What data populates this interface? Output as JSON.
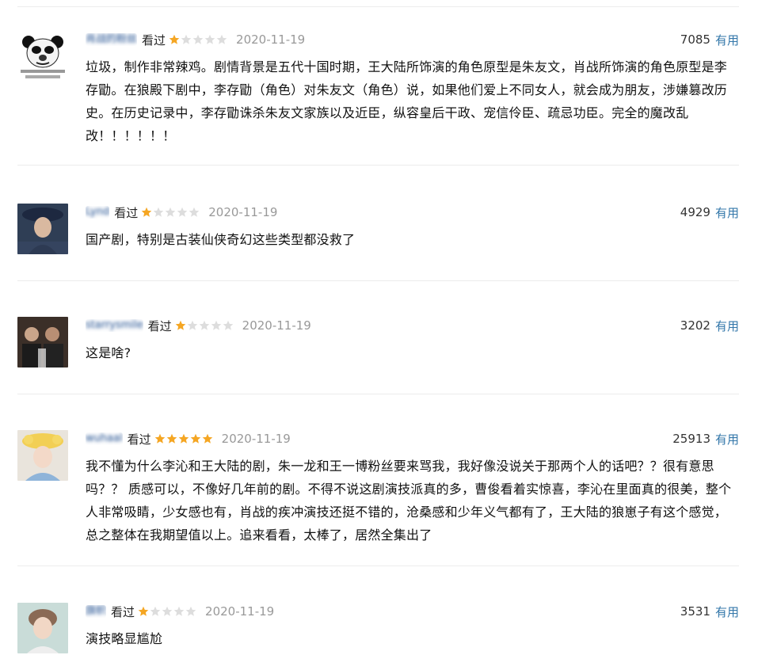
{
  "reviews": [
    {
      "username": "肖战的粉丝",
      "status": "看过",
      "rating": 1,
      "date": "2020-11-19",
      "votes": "7085",
      "useful_label": "有用",
      "avatar_icon": "panda-meme-avatar",
      "content": "垃圾，制作非常辣鸡。剧情背景是五代十国时期，王大陆所饰演的角色原型是朱友文，肖战所饰演的角色原型是李存勖。在狼殿下剧中，李存勖（角色）对朱友文（角色）说，如果他们爱上不同女人，就会成为朋友，涉嫌篡改历史。在历史记录中，李存勖诛杀朱友文家族以及近臣，纵容皇后干政、宠信伶臣、疏忌功臣。完全的魔改乱改！！！！！！"
    },
    {
      "username": "Lynd",
      "status": "看过",
      "rating": 1,
      "date": "2020-11-19",
      "votes": "4929",
      "useful_label": "有用",
      "avatar_icon": "portrait-hat-avatar",
      "content": "国产剧，特别是古装仙侠奇幻这些类型都没救了"
    },
    {
      "username": "starrysmile",
      "status": "看过",
      "rating": 1,
      "date": "2020-11-19",
      "votes": "3202",
      "useful_label": "有用",
      "avatar_icon": "group-photo-avatar",
      "content": "这是啥?"
    },
    {
      "username": "wuhaal",
      "status": "看过",
      "rating": 5,
      "date": "2020-11-19",
      "votes": "25913",
      "useful_label": "有用",
      "avatar_icon": "girl-yellow-hat-avatar",
      "content": "我不懂为什么李沁和王大陆的剧，朱一龙和王一博粉丝要来骂我，我好像没说关于那两个人的话吧？？很有意思吗？？ 质感可以，不像好几年前的剧。不得不说这剧演技派真的多，曹俊看着实惊喜，李沁在里面真的很美，整个人非常吸睛，少女感也有，肖战的疾冲演技还挺不错的，沧桑感和少年义气都有了，王大陆的狼崽子有这个感觉，总之整体在我期望值以上。追来看看，太棒了，居然全集出了"
    },
    {
      "username": "旗帜",
      "status": "看过",
      "rating": 1,
      "date": "2020-11-19",
      "votes": "3531",
      "useful_label": "有用",
      "avatar_icon": "portrait-girl-avatar",
      "content": "演技略显尴尬"
    }
  ]
}
